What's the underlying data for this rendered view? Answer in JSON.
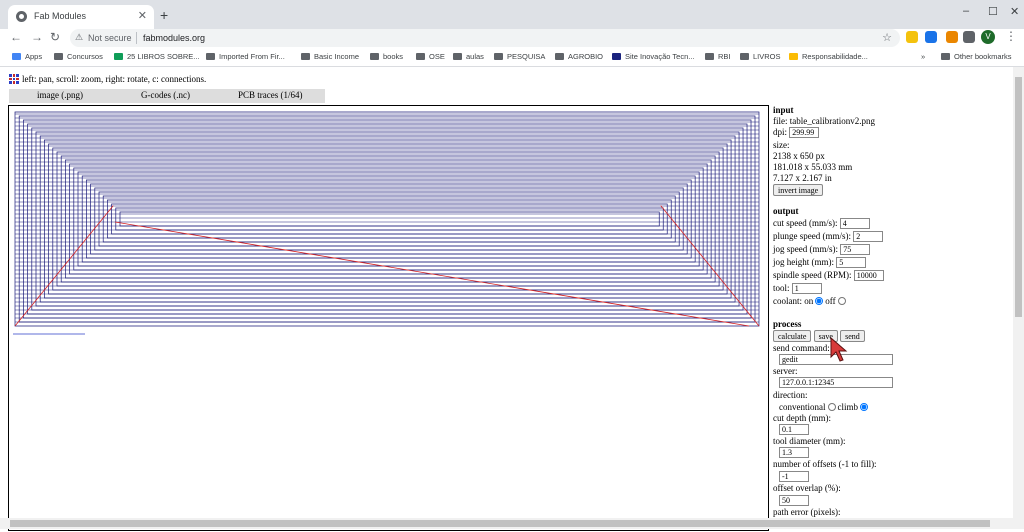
{
  "browser": {
    "tab_title": "Fab Modules",
    "new_tab": "+",
    "win_minimize": "–",
    "win_maximize": "☐",
    "win_close": "✕",
    "back": "←",
    "forward": "→",
    "reload": "↻",
    "not_secure": "Not secure",
    "url": "fabmodules.org",
    "star": "☆",
    "avatar_letter": "V",
    "menu": "⋮"
  },
  "bookmarks": {
    "items": [
      "Apps",
      "Concursos",
      "25 LIBROS SOBRE...",
      "Imported From Fir...",
      "Basic Income",
      "books",
      "OSE",
      "aulas",
      "PESQUISA",
      "AGROBIO",
      "Site Inovação Tecn...",
      "RBI",
      "LIVROS",
      "Responsabilidade..."
    ],
    "more": "»",
    "other": "Other bookmarks"
  },
  "app": {
    "help_text": "left: pan, scroll: zoom, right: rotate, c: connections.",
    "tabs": [
      "image (.png)",
      "G-codes (.nc)",
      "PCB traces (1/64)"
    ],
    "input": {
      "heading": "input",
      "file": "file: table_calibrationv2.png",
      "dpi_label": "dpi:",
      "dpi_value": "299.99",
      "size_label": "size:",
      "size_px": "2138 x 650 px",
      "size_mm": "181.018 x 55.033 mm",
      "size_in": "7.127 x 2.167 in",
      "invert_button": "invert image"
    },
    "output": {
      "heading": "output",
      "cut_speed_label": "cut speed (mm/s):",
      "cut_speed_value": "4",
      "plunge_speed_label": "plunge speed (mm/s):",
      "plunge_speed_value": "2",
      "jog_speed_label": "jog speed (mm/s):",
      "jog_speed_value": "75",
      "jog_height_label": "jog height (mm):",
      "jog_height_value": "5",
      "spindle_label": "spindle speed (RPM):",
      "spindle_value": "10000",
      "tool_label": "tool:",
      "tool_value": "1",
      "coolant_label": "coolant: on",
      "coolant_off_label": "off"
    },
    "process": {
      "heading": "process",
      "calculate_button": "calculate",
      "save_button": "save",
      "send_button": "send",
      "send_command_label": "send command:",
      "send_command_value": "gedit",
      "server_label": "server:",
      "server_value": "127.0.0.1:12345",
      "direction_label": "direction:",
      "conventional_label": "conventional",
      "climb_label": "climb",
      "cut_depth_label": "cut depth (mm):",
      "cut_depth_value": "0.1",
      "tool_diameter_label": "tool diameter (mm):",
      "tool_diameter_value": "1.3",
      "offsets_label": "number of offsets (-1 to fill):",
      "offsets_value": "-1",
      "overlap_label": "offset overlap (%):",
      "overlap_value": "50",
      "path_error_label": "path error (pixels):"
    }
  },
  "colors": {
    "toolpath": "#1a1a7a",
    "jog": "#d62020",
    "tab_strip": "#dee1e6"
  }
}
